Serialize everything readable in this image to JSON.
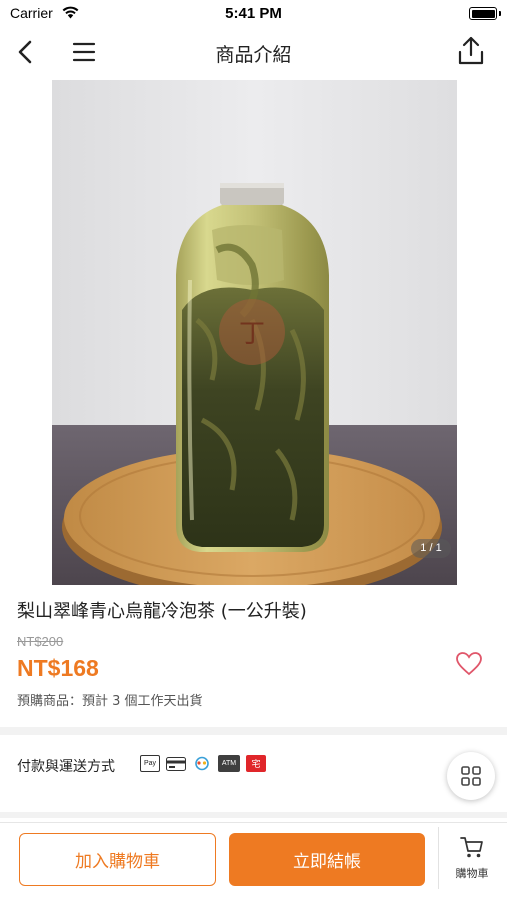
{
  "status_bar": {
    "carrier": "Carrier",
    "time": "5:41 PM"
  },
  "nav": {
    "title": "商品介紹",
    "back_icon": "chevron-left-icon",
    "menu_icon": "hamburger-menu-icon",
    "share_icon": "share-icon"
  },
  "gallery": {
    "counter": "1 / 1"
  },
  "product": {
    "title": "梨山翠峰青心烏龍冷泡茶 (一公升裝)",
    "original_price": "NT$200",
    "price": "NT$168",
    "preorder_note": "預購商品：預計 3 個工作天出貨"
  },
  "payment": {
    "label": "付款與運送方式",
    "methods": [
      "Pay",
      "ATM",
      "宅"
    ]
  },
  "actions": {
    "add_to_cart": "加入購物車",
    "checkout": "立即結帳",
    "cart_tab": "購物車"
  },
  "colors": {
    "accent": "#ee7a22",
    "heart": "#e0566a"
  }
}
